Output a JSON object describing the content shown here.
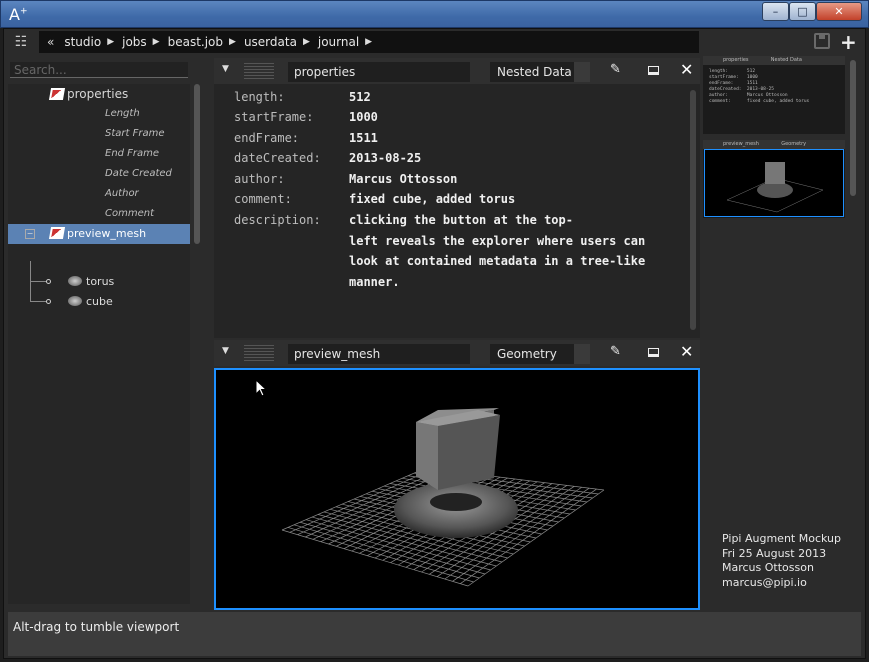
{
  "window": {
    "app_icon": "A",
    "app_icon_sup": "+",
    "minimize": "–",
    "maximize": "□",
    "close": "✕"
  },
  "toolbar": {
    "tree_toggle": "tree-view-icon",
    "back": "«",
    "breadcrumb": [
      "studio",
      "jobs",
      "beast.job",
      "userdata",
      "journal"
    ],
    "save": "save-icon",
    "add": "+"
  },
  "sidebar": {
    "search_placeholder": "Search...",
    "root_item": "properties",
    "attributes": [
      "Length",
      "Start Frame",
      "End Frame",
      "Date Created",
      "Author",
      "Comment"
    ],
    "selected_item": "preview_mesh",
    "children": [
      "torus",
      "cube"
    ]
  },
  "properties_panel": {
    "name": "properties",
    "type": "Nested Data",
    "rows": [
      {
        "key": "length:",
        "value": "512"
      },
      {
        "key": "startFrame:",
        "value": "1000"
      },
      {
        "key": "endFrame:",
        "value": "1511"
      },
      {
        "key": "dateCreated:",
        "value": "2013-08-25"
      },
      {
        "key": "author:",
        "value": "Marcus Ottosson"
      },
      {
        "key": "comment:",
        "value": "fixed cube, added torus"
      },
      {
        "key": "description:",
        "value": ""
      }
    ],
    "description_lines": [
      "clicking the button at the top-",
      "left reveals the explorer where users can",
      "look at contained metadata in a tree-like",
      "manner."
    ]
  },
  "geometry_panel": {
    "name": "preview_mesh",
    "type": "Geometry"
  },
  "minimap": {
    "props_head_name": "properties",
    "props_head_type": "Nested Data",
    "props_text": "length:       512\nstartFrame:   1000\nendFrame:     1511\ndateCreated:  2013-08-25\nauthor:       Marcus Ottosson\ncomment:      fixed cube, added torus",
    "geo_head_name": "preview_mesh",
    "geo_head_type": "Geometry"
  },
  "credits": {
    "line1": "Pipi Augment Mockup",
    "line2": "Fri 25 August 2013",
    "line3": "Marcus Ottosson",
    "line4": "marcus@pipi.io"
  },
  "status": {
    "text": "Alt-drag to tumble viewport"
  }
}
